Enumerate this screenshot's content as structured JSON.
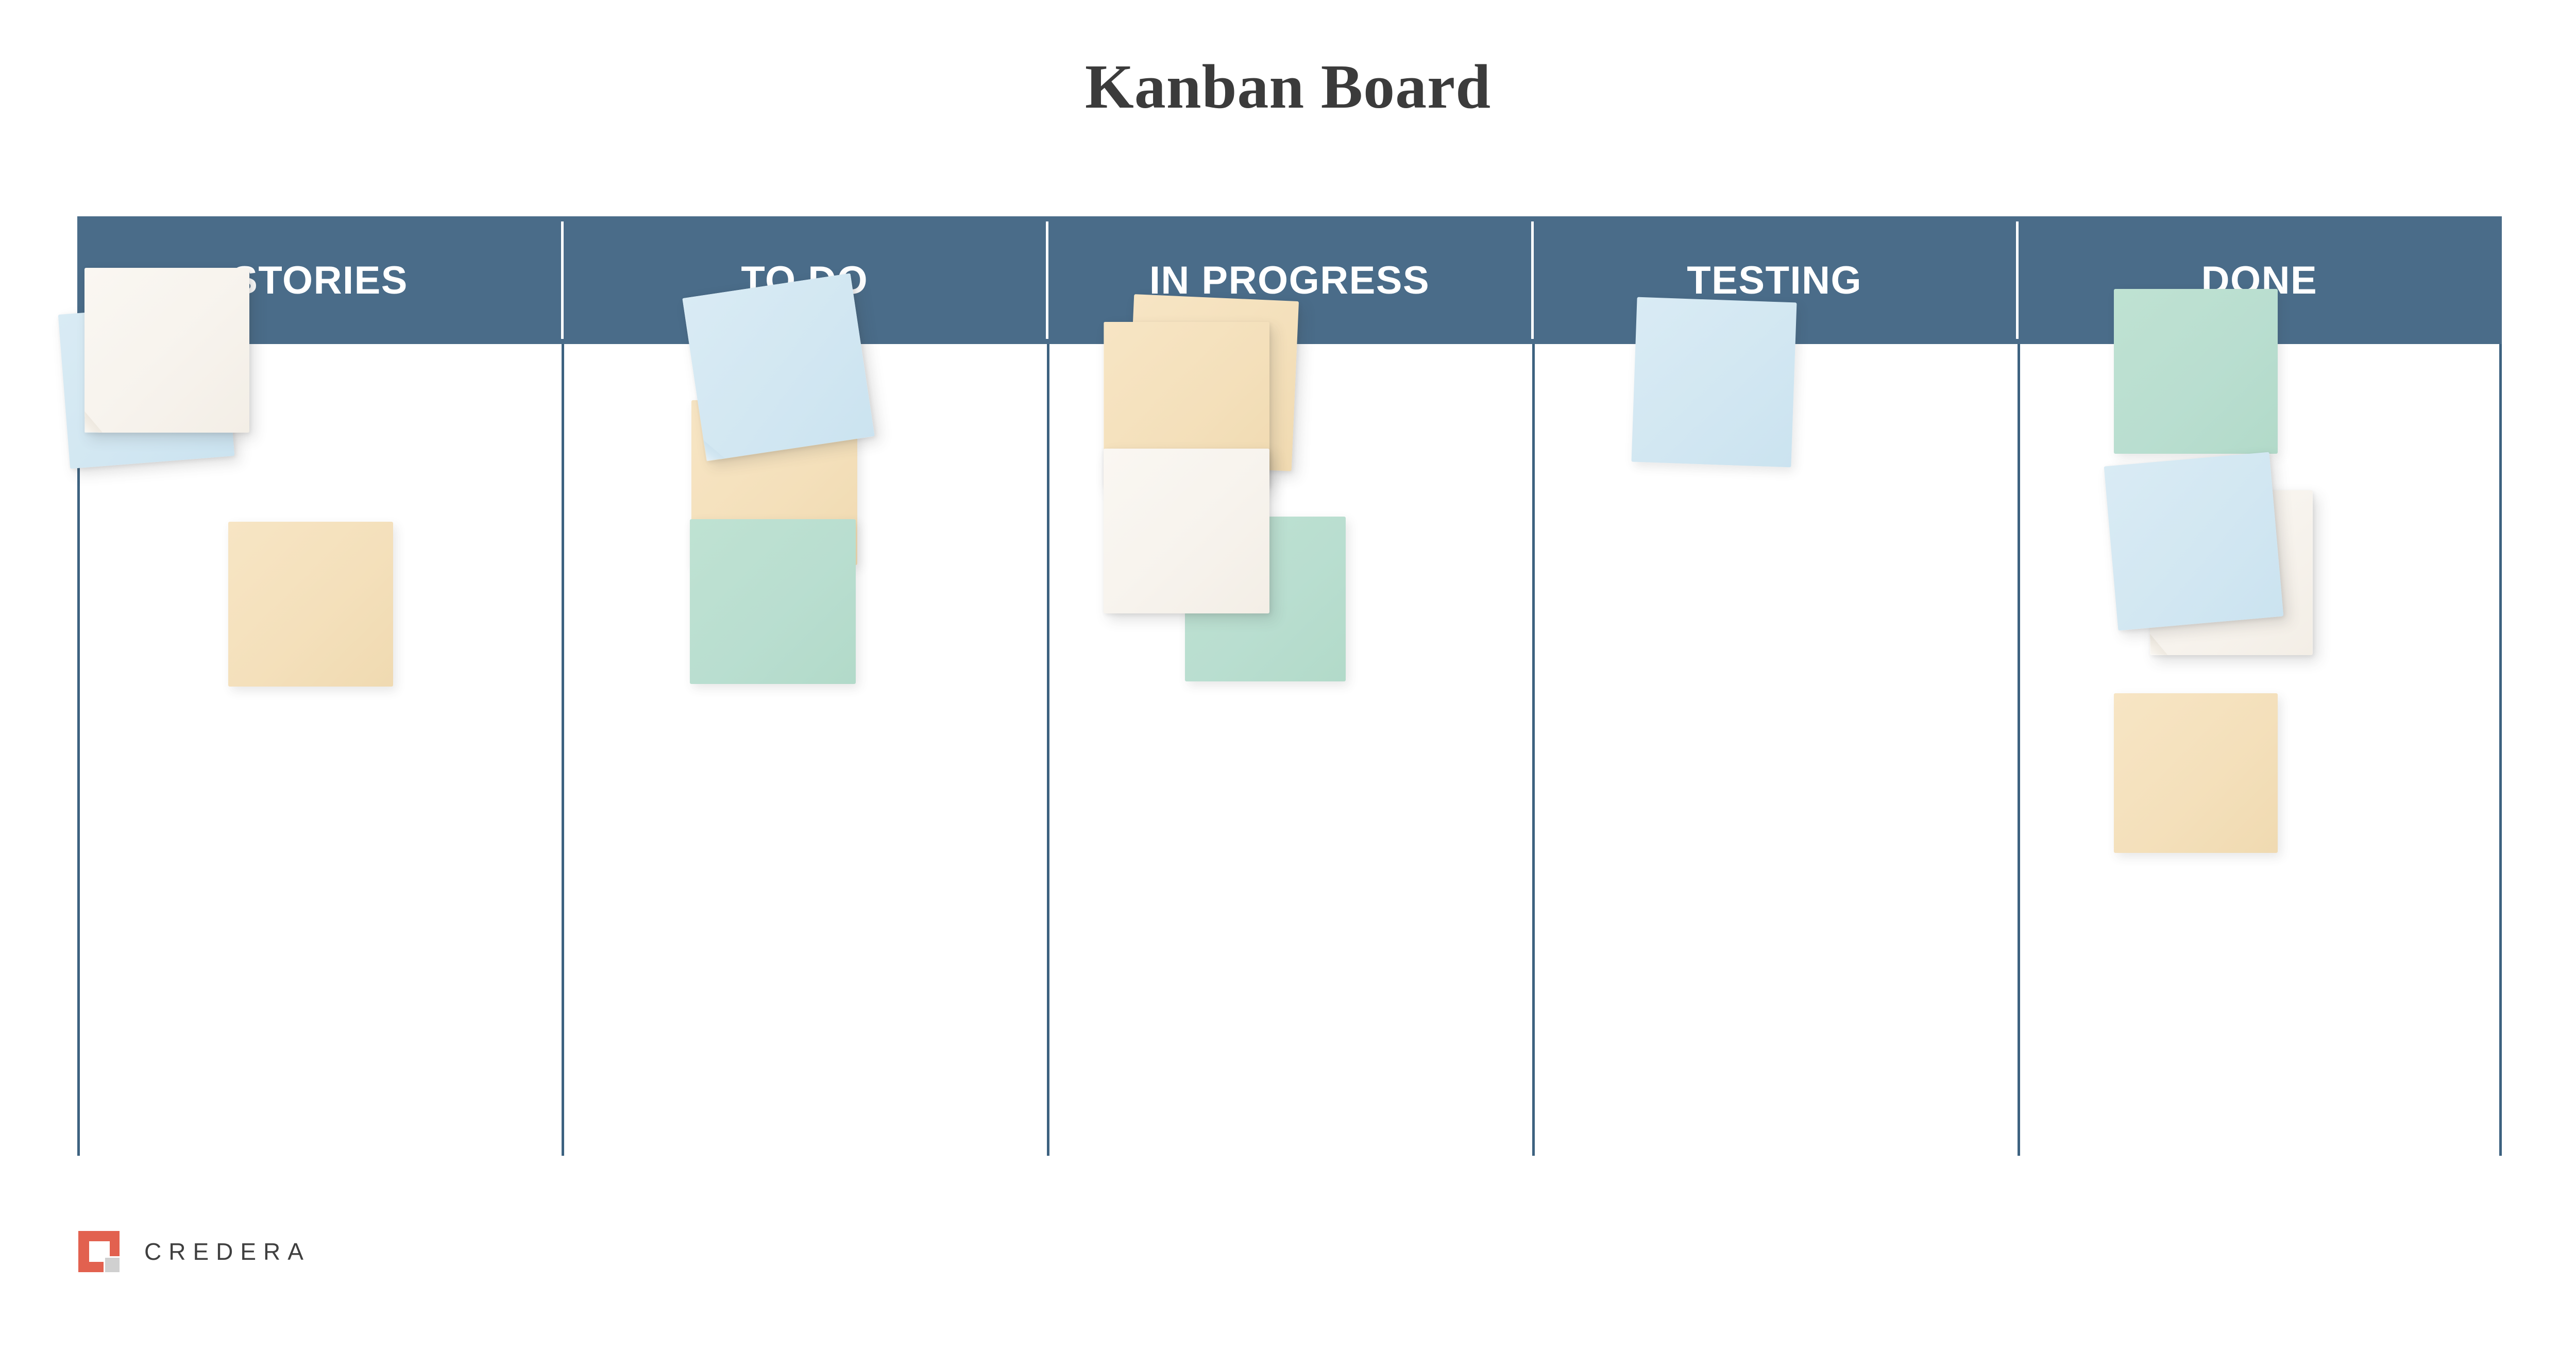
{
  "page": {
    "title": "Kanban Board",
    "background_color": "#ffffff"
  },
  "theme": {
    "header_band_color": "#4a6c89",
    "grid_line_color": "#3d6280",
    "header_text_color": "#ffffff",
    "title_text_color": "#3b3b3b",
    "note_blue": "#d2e7f2",
    "note_cream": "#f7f3ed",
    "note_tan": "#f4e0bb",
    "note_green": "#b9ded0"
  },
  "board": {
    "columns": [
      {
        "header": "STORIES",
        "notes": [
          {
            "color": "cream",
            "label": "sticky-note-cream"
          },
          {
            "color": "blue",
            "label": "sticky-note-blue"
          },
          {
            "color": "tan",
            "label": "sticky-note-tan"
          }
        ]
      },
      {
        "header": "TO DO",
        "notes": [
          {
            "color": "blue",
            "label": "sticky-note-blue"
          },
          {
            "color": "tan",
            "label": "sticky-note-tan"
          },
          {
            "color": "green",
            "label": "sticky-note-green"
          }
        ]
      },
      {
        "header": "IN PROGRESS",
        "notes": [
          {
            "color": "tan",
            "label": "sticky-note-tan-back"
          },
          {
            "color": "tan",
            "label": "sticky-note-tan-front"
          },
          {
            "color": "green",
            "label": "sticky-note-green"
          },
          {
            "color": "cream",
            "label": "sticky-note-cream"
          }
        ]
      },
      {
        "header": "TESTING",
        "notes": [
          {
            "color": "blue",
            "label": "sticky-note-blue"
          }
        ]
      },
      {
        "header": "DONE",
        "notes": [
          {
            "color": "green",
            "label": "sticky-note-green"
          },
          {
            "color": "cream",
            "label": "sticky-note-cream"
          },
          {
            "color": "blue",
            "label": "sticky-note-blue"
          },
          {
            "color": "tan",
            "label": "sticky-note-tan"
          }
        ]
      }
    ]
  },
  "footer": {
    "logo": {
      "wordmark": "CREDERA",
      "mark_color": "#e2614f",
      "mark_accent_color": "#d0d0d0",
      "icon_name": "credera-logo-mark"
    }
  }
}
